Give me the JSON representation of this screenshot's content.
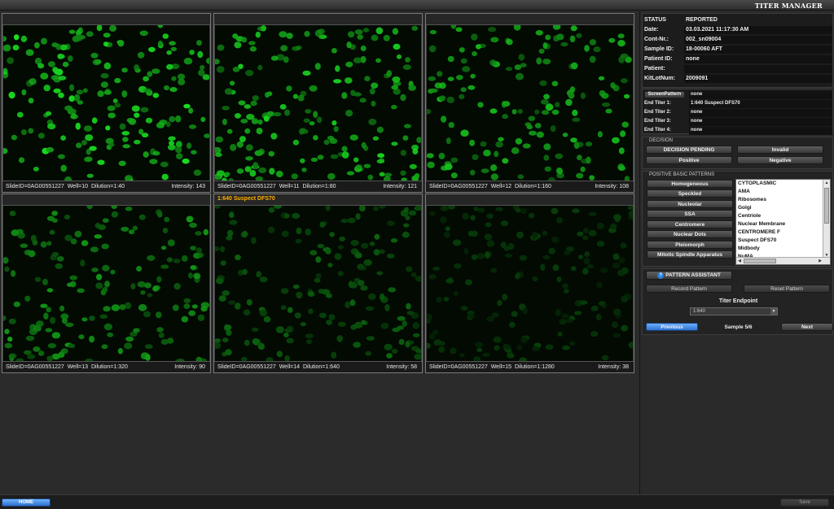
{
  "app": {
    "title": "TITER MANAGER"
  },
  "tiles": [
    {
      "header": "",
      "slide": "SlideID=0AG00551227",
      "well": "Well=10",
      "dilution": "Dilution=1:40",
      "intensity": "Intensity: 143",
      "brightness": 1.0,
      "cells": 190
    },
    {
      "header": "",
      "slide": "SlideID=0AG00551227",
      "well": "Well=11",
      "dilution": "Dilution=1:80",
      "intensity": "Intensity: 121",
      "brightness": 0.92,
      "cells": 190
    },
    {
      "header": "",
      "slide": "SlideID=0AG00551227",
      "well": "Well=12",
      "dilution": "Dilution=1:160",
      "intensity": "Intensity: 108",
      "brightness": 0.85,
      "cells": 160
    },
    {
      "header": "",
      "slide": "SlideID=0AG00551227",
      "well": "Well=13",
      "dilution": "Dilution=1:320",
      "intensity": "Intensity: 90",
      "brightness": 0.7,
      "cells": 170
    },
    {
      "header": "1:640 Suspect DFS70",
      "slide": "SlideID=0AG00551227",
      "well": "Well=14",
      "dilution": "Dilution=1:640",
      "intensity": "Intensity: 58",
      "brightness": 0.45,
      "cells": 170
    },
    {
      "header": "",
      "slide": "SlideID=0AG00551227",
      "well": "Well=15",
      "dilution": "Dilution=1:1280",
      "intensity": "Intensity: 38",
      "brightness": 0.3,
      "cells": 160
    }
  ],
  "status": [
    {
      "label": "STATUS",
      "value": "REPORTED"
    },
    {
      "label": "Date:",
      "value": "03.03.2021  11:17:30 AM"
    },
    {
      "label": "Cont-Nr.:",
      "value": "002_sn09004"
    },
    {
      "label": "Sample ID:",
      "value": "18-00060 AFT"
    },
    {
      "label": "Patient ID:",
      "value": "none"
    },
    {
      "label": "Patient:",
      "value": ""
    },
    {
      "label": "KitLotNum:",
      "value": "2009091"
    }
  ],
  "titer": {
    "screen_button": "ScreenPattern",
    "screen_value": "none",
    "rows": [
      {
        "label": "End Titer 1:",
        "value": "1:640 Suspect DFS70"
      },
      {
        "label": "End Titer 2:",
        "value": "none"
      },
      {
        "label": "End Titer 3:",
        "value": "none"
      },
      {
        "label": "End Titer 4:",
        "value": "none"
      }
    ]
  },
  "decision": {
    "label": "DECISION",
    "pending": "DECISION PENDING",
    "invalid": "Invalid",
    "positive": "Positive",
    "negative": "Negative"
  },
  "patterns": {
    "label": "POSITIVE BASIC PATTERNS",
    "buttons": [
      "Homogeneous",
      "Speckled",
      "Nucleolar",
      "SSA",
      "Centromere",
      "Nuclear Dots",
      "Pleiomorph",
      "Mitotic Spindle Apparatus"
    ],
    "list": [
      "CYTOPLASMIC",
      "AMA",
      "Ribosomes",
      "Golgi",
      "Centriole",
      "Nuclear Membrane",
      "CENTROMERE F",
      "Suspect DFS70",
      "Midbody",
      "NuMA"
    ]
  },
  "assistant": {
    "button": "PATTERN ASSISTANT",
    "record": "Record Pattern",
    "reset": "Reset Pattern",
    "endpoint_label": "Titer Endpoint",
    "endpoint_value": "1:640",
    "previous": "Previous",
    "sample": "Sample 5/6",
    "next": "Next"
  },
  "footer": {
    "home": "HOME",
    "save": "Save"
  },
  "colors": {
    "fluorescence": "#22d62a",
    "accent_blue": "#2e6fcc",
    "header_text": "#ffb000"
  }
}
